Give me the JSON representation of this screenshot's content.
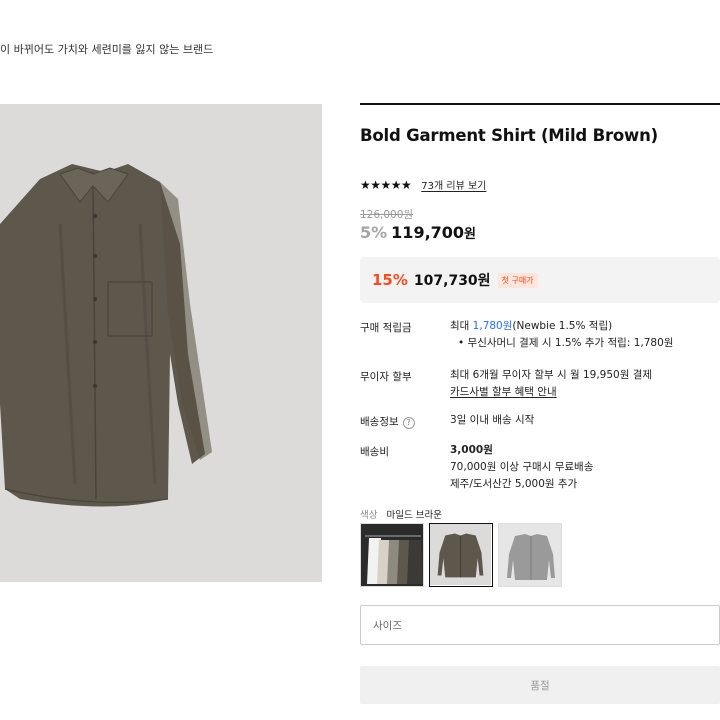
{
  "brand": {
    "description": "이 바뀌어도 가치와 세련미를 잃지 않는 브랜드"
  },
  "product": {
    "title": "Bold Garment Shirt (Mild Brown)",
    "rating": {
      "stars": "★★★★★",
      "review_link": "73개 리뷰 보기",
      "value": 5
    },
    "original_price": "126,000원",
    "discount_rate": "5%",
    "sale_price": "119,700",
    "currency_unit": "원",
    "first_purchase": {
      "rate": "15%",
      "price": "107,730원",
      "badge": "첫 구매가"
    }
  },
  "details": {
    "points": {
      "label": "구매 적립금",
      "line1_prefix": "최대 ",
      "line1_amount": "1,780원",
      "line1_suffix": "(Newbie 1.5% 적립)",
      "bullet": "• 무신사머니 결제 시 1.5% 추가 적립: 1,780원"
    },
    "installment": {
      "label": "무이자 할부",
      "line1": "최대 6개월 무이자 할부 시 월 19,950원 결제",
      "link": "카드사별 할부 혜택 안내"
    },
    "shipping_info": {
      "label": "배송정보",
      "help_icon": "?",
      "value": "3일 이내 배송 시작"
    },
    "shipping_fee": {
      "label": "배송비",
      "fee": "3,000원",
      "free_line": "70,000원 이상 구매시 무료배송",
      "island_line": "제주/도서산간 5,000원 추가"
    }
  },
  "options": {
    "color_label": "색상",
    "color_value": "마일드 브라운",
    "size_placeholder": "사이즈",
    "soldout_label": "품절"
  },
  "colors": {
    "accent": "#2a6ff0",
    "discount": "#ff4b1f",
    "shirt": "#5e574c"
  },
  "icons": [
    "star-icon",
    "help-circle-icon"
  ]
}
